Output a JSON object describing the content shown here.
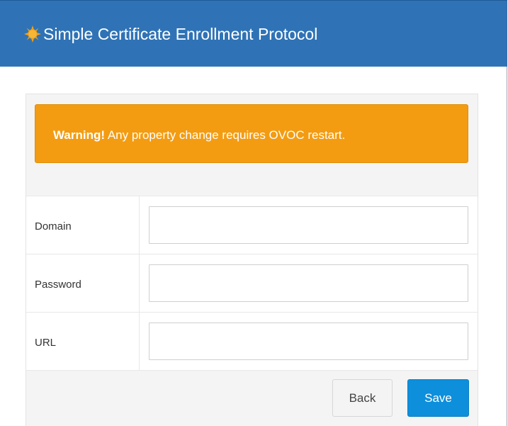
{
  "header": {
    "icon": "sun-icon",
    "title": "Simple Certificate Enrollment Protocol",
    "background": "#2f73b6"
  },
  "alert": {
    "strong": "Warning!",
    "message": " Any property change requires OVOC restart.",
    "color": "#f39c12"
  },
  "form": {
    "fields": [
      {
        "label": "Domain",
        "value": ""
      },
      {
        "label": "Password",
        "value": ""
      },
      {
        "label": "URL",
        "value": ""
      }
    ]
  },
  "buttons": {
    "back_label": "Back",
    "save_label": "Save",
    "save_color": "#0d8fdc"
  }
}
